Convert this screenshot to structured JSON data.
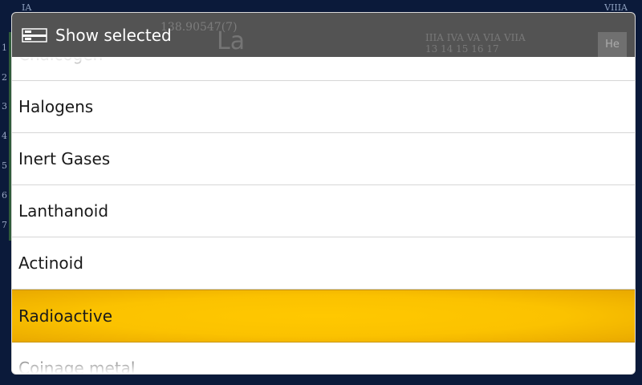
{
  "background": {
    "group_left": "IA",
    "group_right": "VIIIA",
    "row_numbers": [
      "1",
      "2",
      "3",
      "4",
      "5",
      "6",
      "7"
    ],
    "ghost_weight": "138.90547(7)",
    "ghost_symbol": "La",
    "ghost_cells_top": "IIIA  IVA  VA  VIA  VIIA",
    "ghost_cells_bottom": "13   14   15   16   17",
    "ghost_he": "He"
  },
  "dialog": {
    "title": "Show selected",
    "title_icon": "list-select-icon",
    "items": [
      {
        "label": "Chalcogen",
        "state": "faded"
      },
      {
        "label": "Halogens",
        "state": "normal"
      },
      {
        "label": "Inert Gases",
        "state": "normal"
      },
      {
        "label": "Lanthanoid",
        "state": "normal"
      },
      {
        "label": "Actinoid",
        "state": "normal"
      },
      {
        "label": "Radioactive",
        "state": "selected"
      },
      {
        "label": "Coinage metal",
        "state": "faded"
      }
    ],
    "colors": {
      "selected": "#ffc800",
      "title_bar": "#464646"
    }
  }
}
